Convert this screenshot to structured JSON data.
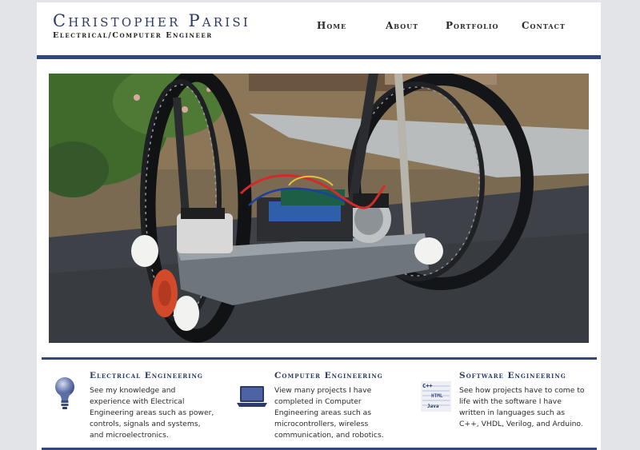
{
  "header": {
    "name": "Christopher Parisi",
    "subtitle": "Electrical/Computer Engineer"
  },
  "nav": [
    {
      "label": "Home"
    },
    {
      "label": "About"
    },
    {
      "label": "Portfolio"
    },
    {
      "label": "Contact"
    }
  ],
  "hero": {
    "icon": "hero-photo-self-balancing-robot"
  },
  "features": [
    {
      "title": "Electrical Engineering",
      "icon": "lightbulb-icon",
      "body": "See my knowledge and experience with Electrical Engineering areas such as power, controls, signals and systems, and microelectronics."
    },
    {
      "title": "Computer Engineering",
      "icon": "laptop-icon",
      "body": "View many projects I have completed in Computer Engineering areas such as microcontrollers, wireless communication, and robotics."
    },
    {
      "title": "Software Engineering",
      "icon": "code-icon",
      "body": "See how projects have to come to life with the software I have written in languages such as C++, VHDL, Verilog, and Arduino.",
      "icon_labels": [
        "C++",
        "HTML",
        "Java"
      ]
    }
  ],
  "colors": {
    "accent": "#34477a",
    "title": "#2b3a66",
    "background": "#e3e4e7"
  }
}
